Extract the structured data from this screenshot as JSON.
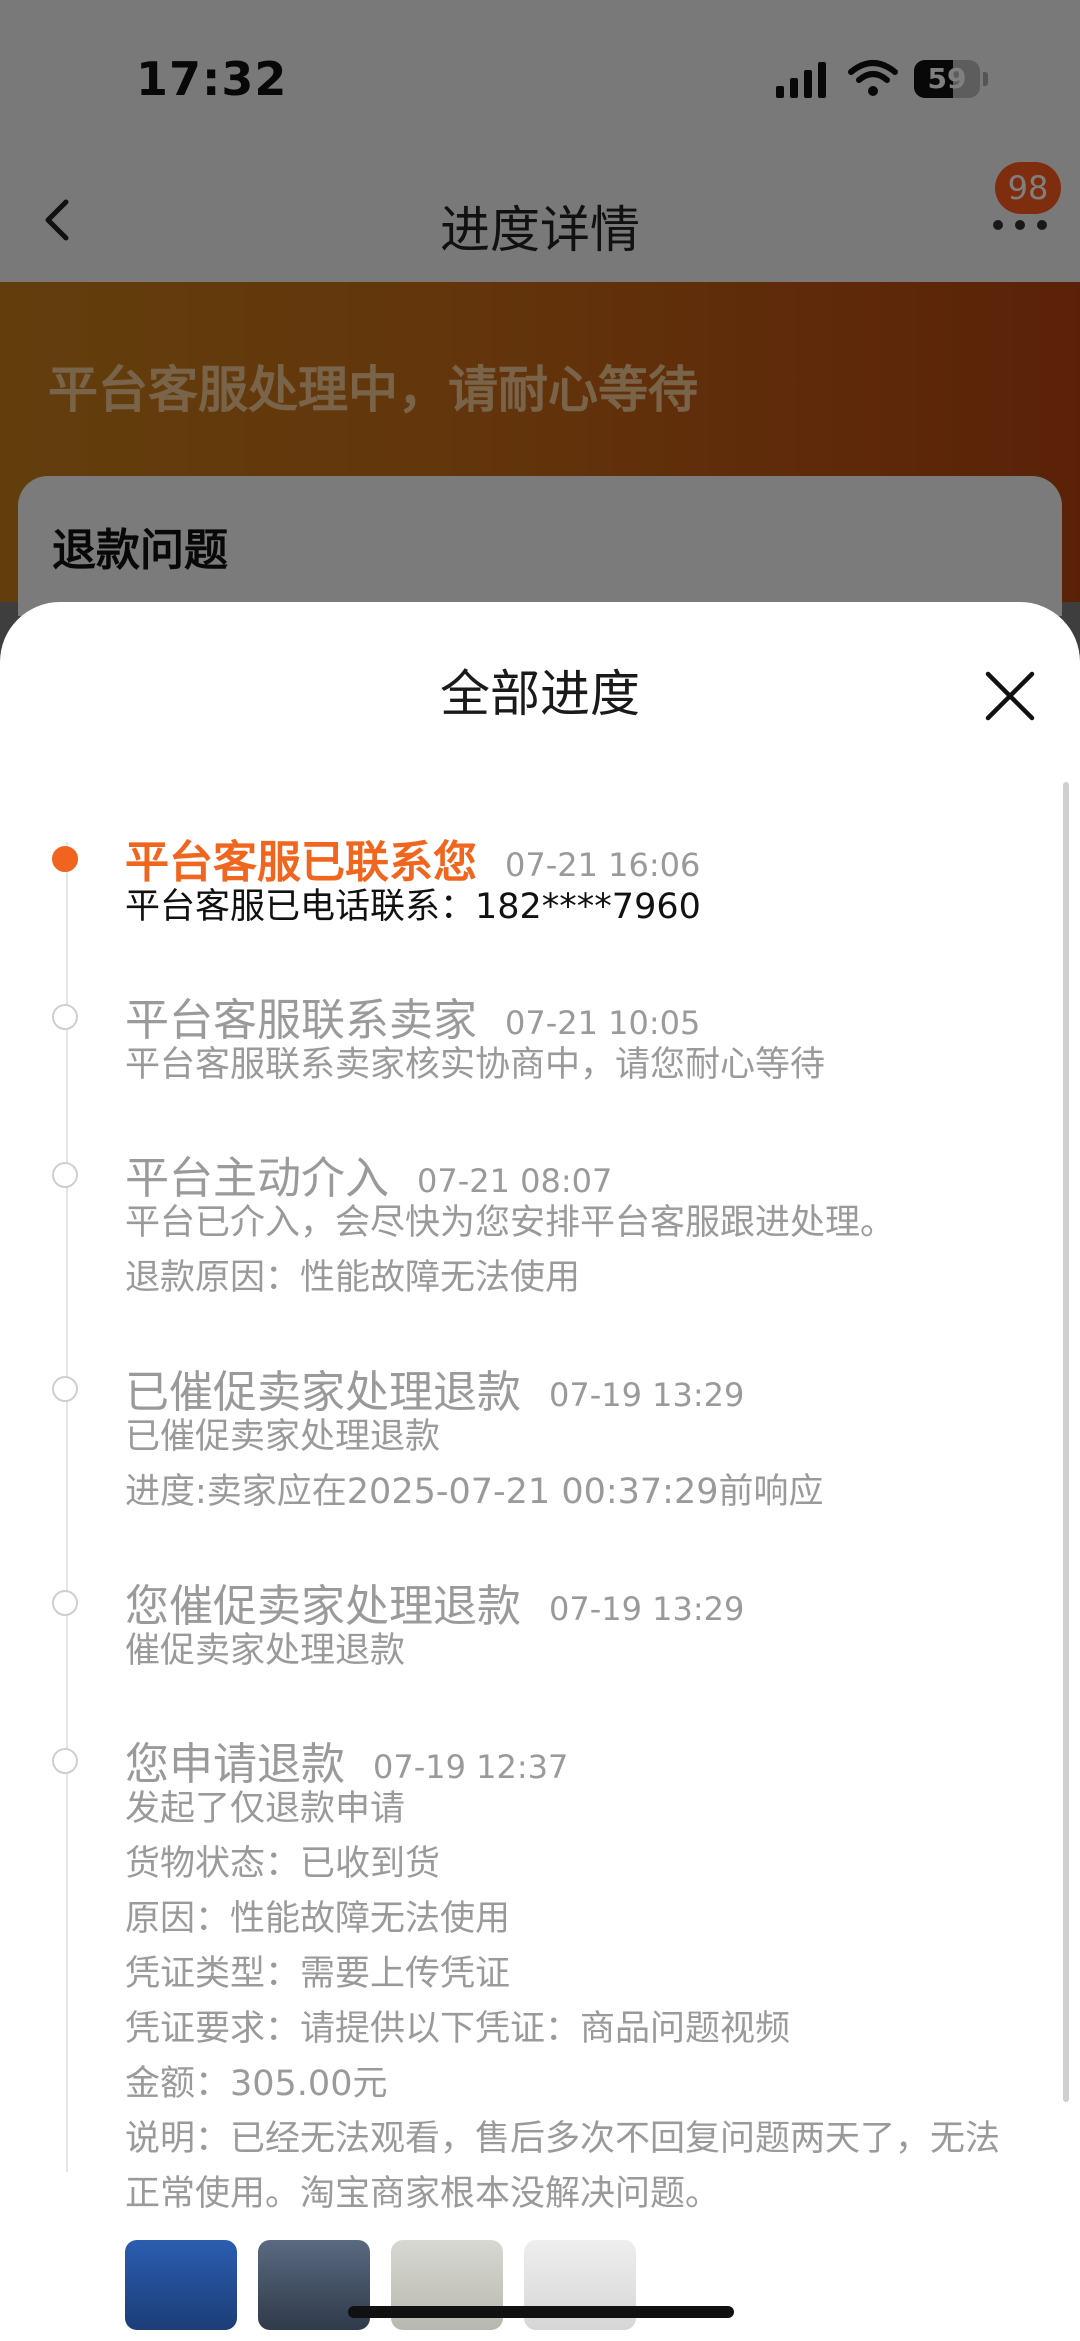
{
  "status_bar": {
    "time": "17:32",
    "battery": "59"
  },
  "nav": {
    "title": "进度详情",
    "badge": "98"
  },
  "hero": {
    "status_text": "平台客服处理中，请耐心等待"
  },
  "card": {
    "title": "退款问题"
  },
  "sheet": {
    "title": "全部进度",
    "entries": [
      {
        "title": "平台客服已联系您",
        "time": "07-21 16:06",
        "active": true,
        "lines": [
          "平台客服已电话联系：182****7960"
        ]
      },
      {
        "title": "平台客服联系卖家",
        "time": "07-21 10:05",
        "lines": [
          "平台客服联系卖家核实协商中，请您耐心等待"
        ]
      },
      {
        "title": "平台主动介入",
        "time": "07-21 08:07",
        "lines": [
          "平台已介入，会尽快为您安排平台客服跟进处理。",
          "退款原因：性能故障无法使用"
        ]
      },
      {
        "title": "已催促卖家处理退款",
        "time": "07-19 13:29",
        "lines": [
          "已催促卖家处理退款",
          "进度:卖家应在2025-07-21 00:37:29前响应"
        ]
      },
      {
        "title": "您催促卖家处理退款",
        "time": "07-19 13:29",
        "lines": [
          "催促卖家处理退款"
        ]
      },
      {
        "title": "您申请退款",
        "time": "07-19 12:37",
        "lines": [
          "发起了仅退款申请",
          "货物状态：已收到货",
          "原因：性能故障无法使用",
          "凭证类型：需要上传凭证",
          "凭证要求：请提供以下凭证：商品问题视频",
          "金额：305.00元",
          "说明：已经无法观看，售后多次不回复问题两天了，无法正常使用。淘宝商家根本没解决问题。"
        ]
      }
    ]
  },
  "colors": {
    "accent": "#f0661f",
    "badge": "#ff5a1f",
    "muted_text": "#9a9a9a"
  }
}
